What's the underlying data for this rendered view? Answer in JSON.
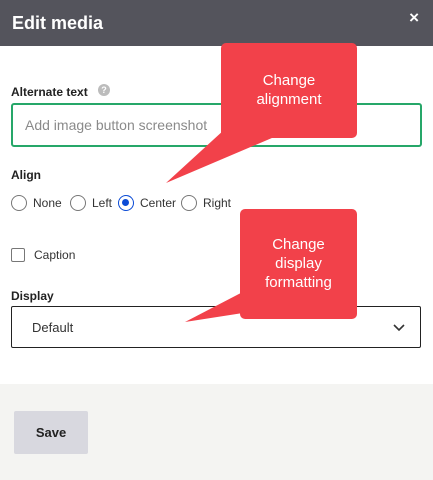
{
  "dialog": {
    "title": "Edit media",
    "close_glyph": "×",
    "close_icon": "close-icon"
  },
  "alt_text": {
    "label": "Alternate text",
    "help_glyph": "?",
    "help_icon": "help-icon",
    "placeholder": "Add image button screenshot",
    "value": ""
  },
  "align": {
    "label": "Align",
    "options": [
      {
        "label": "None",
        "checked": false
      },
      {
        "label": "Left",
        "checked": false
      },
      {
        "label": "Center",
        "checked": true
      },
      {
        "label": "Right",
        "checked": false
      }
    ]
  },
  "caption": {
    "label": "Caption",
    "checked": false
  },
  "display": {
    "label": "Display",
    "selected": "Default",
    "chevron_icon": "chevron-down-icon"
  },
  "footer": {
    "save_label": "Save"
  },
  "annotations": {
    "callout_1": {
      "line1": "Change",
      "line2": "alignment"
    },
    "callout_2": {
      "line1": "Change",
      "line2": "display",
      "line3": "formatting"
    },
    "color": "#f2414a"
  },
  "colors": {
    "titlebar": "#54545c",
    "focus_border": "#26a769",
    "radio_checked": "#0b4bd6",
    "footer_bg": "#f4f4f2",
    "save_button_bg": "#d8d8df"
  }
}
